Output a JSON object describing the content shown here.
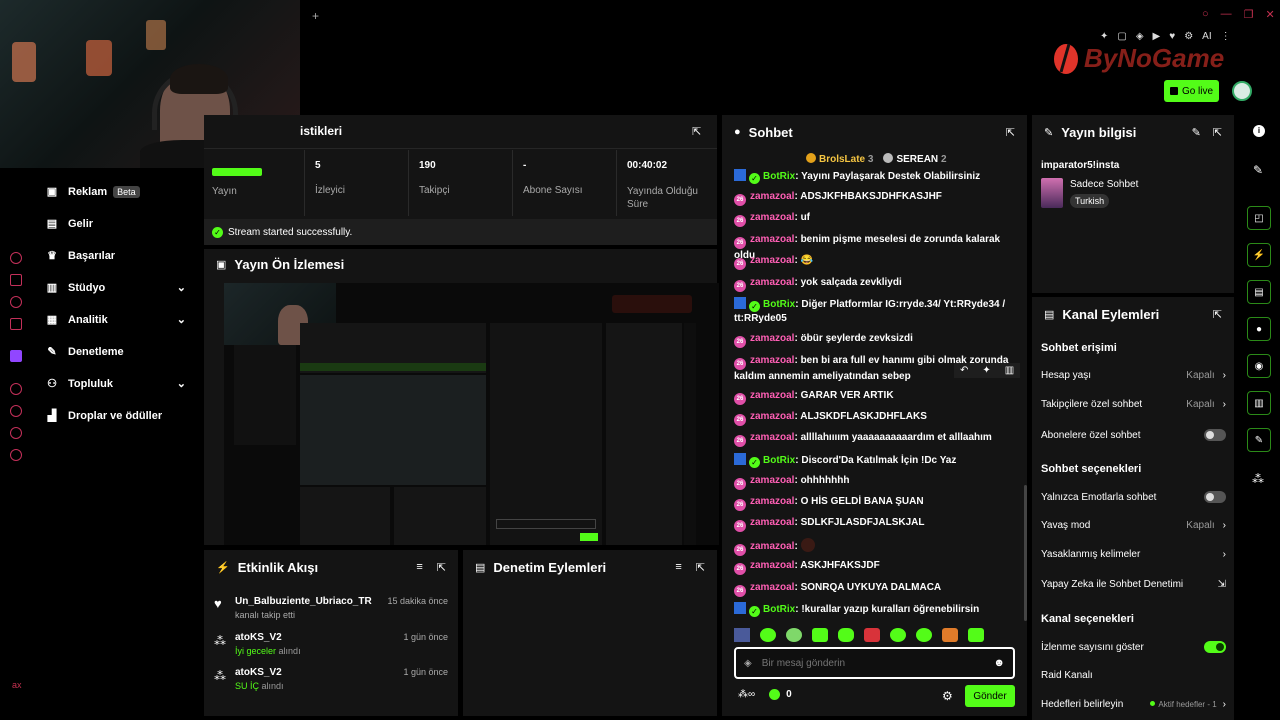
{
  "topbar": {
    "plus": "+",
    "ai_label": "AI",
    "go_live": "Go live"
  },
  "brand": {
    "logo_text": "ByNoGame"
  },
  "nav": {
    "items": [
      {
        "label": "Reklam",
        "badge": "Beta"
      },
      {
        "label": "Gelir"
      },
      {
        "label": "Başarılar"
      },
      {
        "label": "Stüdyo"
      },
      {
        "label": "Analitik"
      },
      {
        "label": "Denetleme"
      },
      {
        "label": "Topluluk"
      },
      {
        "label": "Droplar ve ödüller"
      }
    ]
  },
  "stats": {
    "title_partial": "istikleri",
    "status_label": "Yayın",
    "viewers": {
      "value": "5",
      "label": "İzleyici"
    },
    "followers": {
      "value": "190",
      "label": "Takipçi"
    },
    "subs": {
      "value": "-",
      "label": "Abone Sayısı"
    },
    "duration": {
      "value": "00:40:02",
      "label": "Yayında Olduğu Süre"
    },
    "started": "Stream started successfully."
  },
  "preview": {
    "title": "Yayın Ön İzlemesi"
  },
  "activity": {
    "title": "Etkinlik Akışı",
    "items": [
      {
        "user": "Un_Balbuziente_Ubriaco_TR",
        "time": "15 dakika önce",
        "action": "kanalı takip etti",
        "highlight": ""
      },
      {
        "user": "atoKS_V2",
        "time": "1 gün önce",
        "highlight": "İyi geceler",
        "action": "alındı"
      },
      {
        "user": "atoKS_V2",
        "time": "1 gün önce",
        "highlight": "SU İÇ",
        "action": "alındı"
      }
    ]
  },
  "moderation": {
    "title": "Denetim Eylemleri"
  },
  "chat": {
    "title": "Sohbet",
    "top": [
      {
        "name": "BrolsLate",
        "count": "3"
      },
      {
        "name": "SEREAN",
        "count": "2"
      }
    ],
    "messages": [
      {
        "user": "BotRix",
        "text": "Yayını Paylaşarak Destek Olabilirsiniz",
        "bot": true
      },
      {
        "user": "zamazoal",
        "text": "ADSJKFHBAKSJDHFKASJHF"
      },
      {
        "user": "zamazoal",
        "text": "uf"
      },
      {
        "user": "zamazoal",
        "text": "benim pişme meselesi de zorunda kalarak oldu"
      },
      {
        "user": "zamazoal",
        "text": "😂"
      },
      {
        "user": "zamazoal",
        "text": "yok salçada zevkliydi"
      },
      {
        "user": "BotRix",
        "text": "Diğer Platformlar IG:rryde.34/ Yt:RRyde34 / tt:RRyde05",
        "bot": true
      },
      {
        "user": "zamazoal",
        "text": "öbür şeylerde zevksizdi"
      },
      {
        "user": "zamazoal",
        "text": "ben bi ara full ev hanımı gibi olmak zorunda kaldım annemin ameliyatından sebep"
      },
      {
        "user": "zamazoal",
        "text": "GARAR VER ARTIK"
      },
      {
        "user": "zamazoal",
        "text": "ALJSKDFLASKJDHFLAKS"
      },
      {
        "user": "zamazoal",
        "text": "allllahıııım yaaaaaaaaaardım et alllaahım"
      },
      {
        "user": "BotRix",
        "text": "Discord'Da Katılmak İçin !Dc Yaz",
        "bot": true
      },
      {
        "user": "zamazoal",
        "text": "ohhhhhhh"
      },
      {
        "user": "zamazoal",
        "text": "O HİS GELDİ BANA ŞUAN"
      },
      {
        "user": "zamazoal",
        "text": "SDLKFJLASDFJALSKJAL"
      },
      {
        "user": "zamazoal",
        "text": ""
      },
      {
        "user": "zamazoal",
        "text": "ASKJHFAKSJDF"
      },
      {
        "user": "zamazoal",
        "text": "SONRQA UYKUYA DALMACA"
      },
      {
        "user": "BotRix",
        "text": "!kurallar yazıp kuralları öğrenebilirsin",
        "bot": true
      }
    ],
    "placeholder": "Bir mesaj gönderin",
    "points": "0",
    "send": "Gönder"
  },
  "stream_info": {
    "title": "Yayın bilgisi",
    "stream_title": "imparator5!insta",
    "category": "Sadece Sohbet",
    "tag": "Turkish"
  },
  "channel_actions": {
    "title": "Kanal Eylemleri",
    "chat_access": "Sohbet erişimi",
    "account_age": {
      "label": "Hesap yaşı",
      "value": "Kapalı"
    },
    "followers_only": {
      "label": "Takipçilere özel sohbet",
      "value": "Kapalı"
    },
    "subs_only": "Abonelere özel sohbet",
    "chat_options": "Sohbet seçenekleri",
    "emotes_only": "Yalnızca Emotlarla sohbet",
    "slow_mode": {
      "label": "Yavaş mod",
      "value": "Kapalı"
    },
    "banned_words": "Yasaklanmış kelimeler",
    "ai_moderation": "Yapay Zeka ile Sohbet Denetimi",
    "channel_options": "Kanal seçenekleri",
    "show_viewers": "İzlenme sayısını göster",
    "raid": "Raid Kanalı",
    "goals": {
      "label": "Hedefleri belirleyin",
      "value": "Aktif hedefler - 1"
    }
  },
  "colors": {
    "accent": "#53fc18",
    "bg": "#000000",
    "panel": "#141414",
    "pink": "#ff5fb5",
    "brand_red": "#e0342a"
  }
}
